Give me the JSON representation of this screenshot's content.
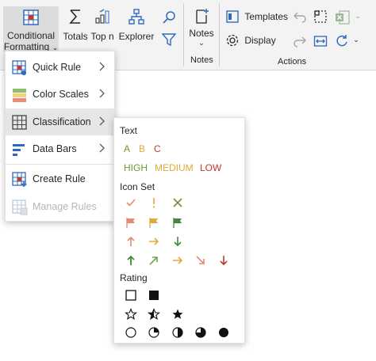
{
  "ribbon": {
    "conditional_formatting_line1": "Conditional",
    "conditional_formatting_line2": "Formatting",
    "totals": "Totals",
    "top_n": "Top n",
    "explorer": "Explorer",
    "notes": "Notes",
    "notes_group": "Notes",
    "templates": "Templates",
    "display": "Display",
    "actions_group": "Actions"
  },
  "menu": {
    "items": [
      {
        "label": "Quick Rule"
      },
      {
        "label": "Color Scales"
      },
      {
        "label": "Classification"
      },
      {
        "label": "Data Bars"
      },
      {
        "label": "Create Rule"
      },
      {
        "label": "Manage Rules"
      }
    ]
  },
  "submenu": {
    "text_header": "Text",
    "letters": [
      "A",
      "B",
      "C"
    ],
    "levels": [
      "HIGH",
      "MEDIUM",
      "LOW"
    ],
    "iconset_header": "Icon Set",
    "rating_header": "Rating"
  },
  "colors": {
    "good": "#6a9b3a",
    "mid": "#e0a93b",
    "bad": "#c0392b",
    "accent": "#2e6bbf"
  }
}
